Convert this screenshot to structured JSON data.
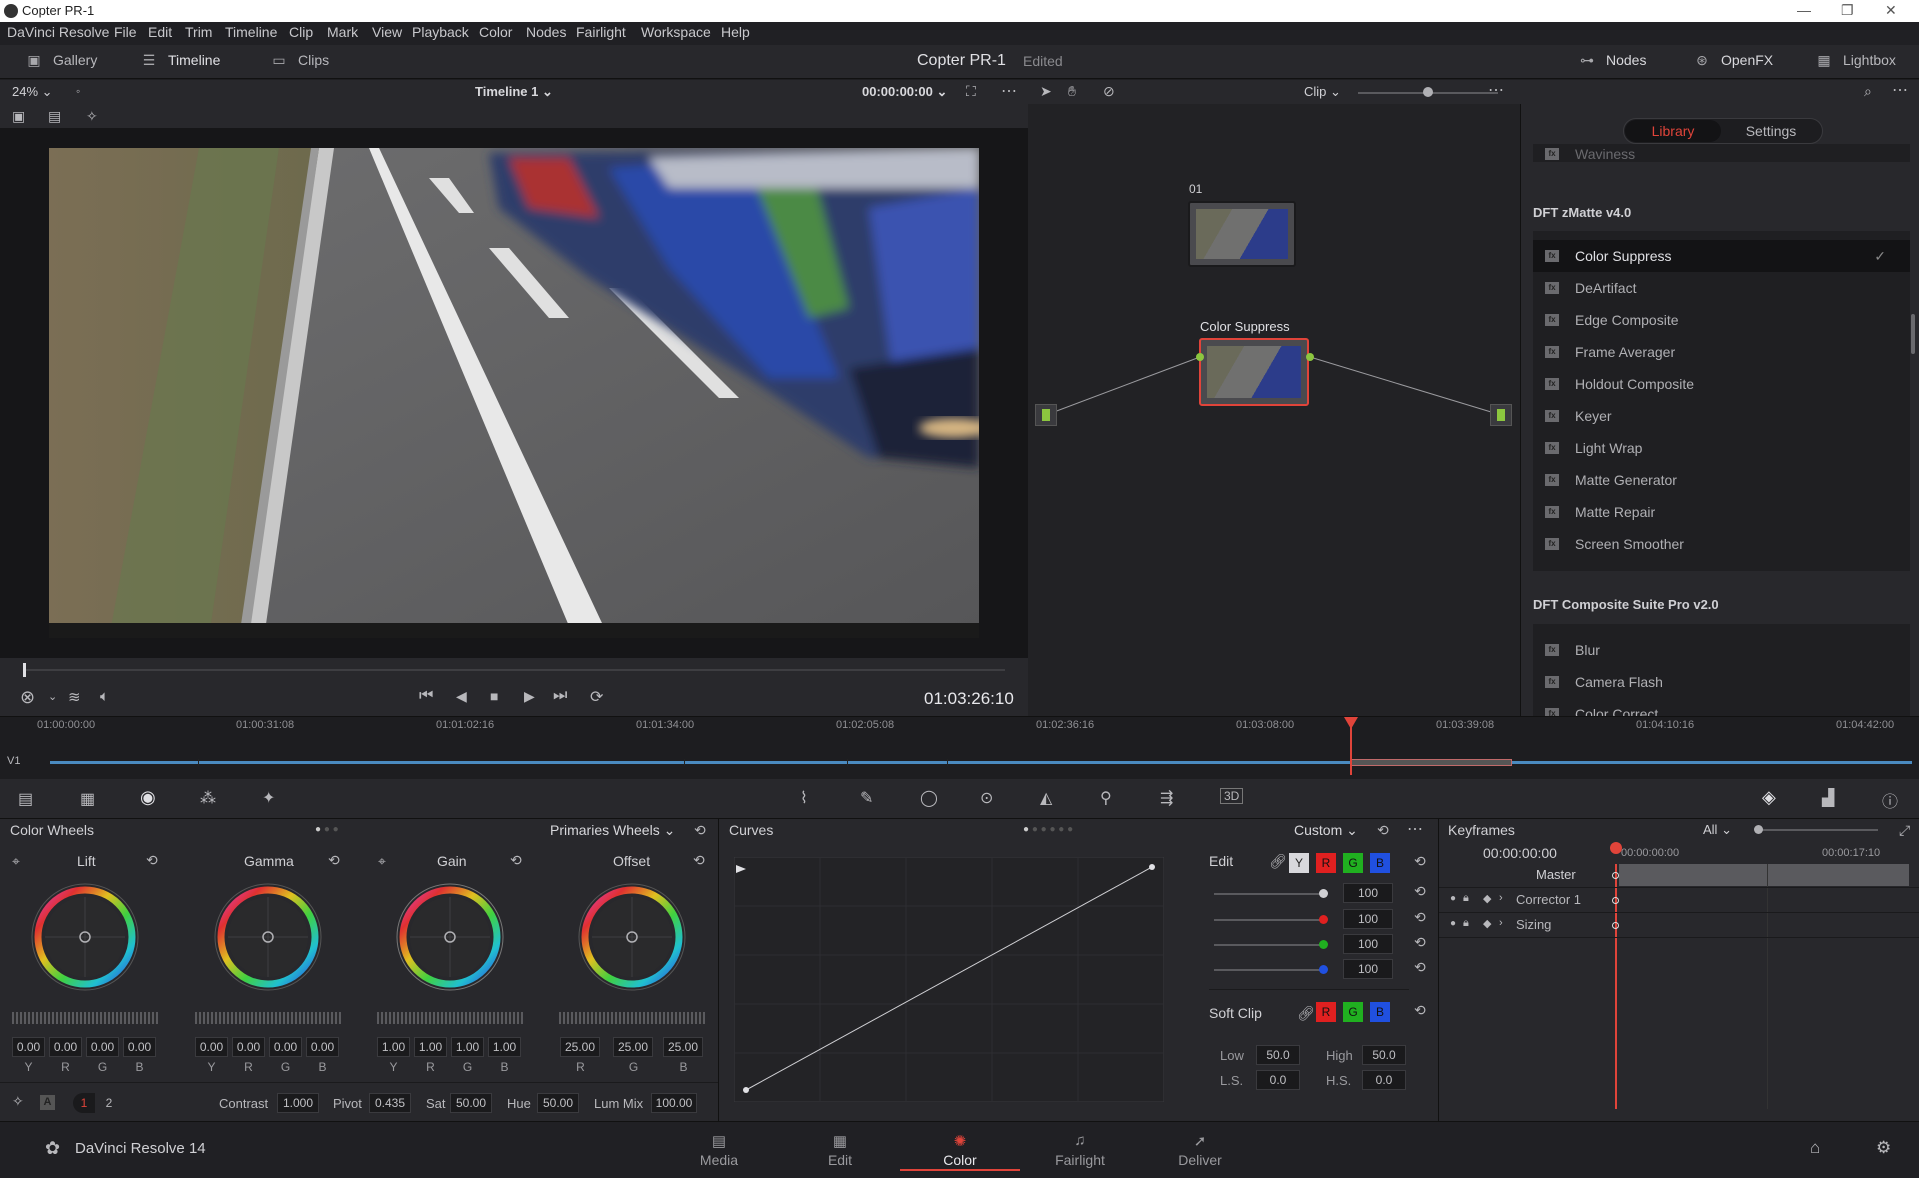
{
  "window": {
    "title": "Copter PR-1"
  },
  "menu": [
    "DaVinci Resolve",
    "File",
    "Edit",
    "Trim",
    "Timeline",
    "Clip",
    "Mark",
    "View",
    "Playback",
    "Color",
    "Nodes",
    "Fairlight",
    "Workspace",
    "Help"
  ],
  "toolbar": {
    "gallery": "Gallery",
    "timeline": "Timeline",
    "clips": "Clips",
    "project": "Copter PR-1",
    "status": "Edited",
    "nodes": "Nodes",
    "openfx": "OpenFX",
    "lightbox": "Lightbox"
  },
  "viewer": {
    "zoom": "24%",
    "timeline_name": "Timeline 1",
    "timecode": "00:00:00:00",
    "current_tc": "01:03:26:10"
  },
  "nodes_panel": {
    "mode": "Clip",
    "node1_label": "01",
    "node2_label": "Color Suppress",
    "zoom_level": 0.5
  },
  "library": {
    "tab_library": "Library",
    "tab_settings": "Settings",
    "partial_top": "Waviness",
    "group1": "DFT zMatte v4.0",
    "group1_items": [
      "Color Suppress",
      "DeArtifact",
      "Edge Composite",
      "Frame Averager",
      "Holdout Composite",
      "Keyer",
      "Light Wrap",
      "Matte Generator",
      "Matte Repair",
      "Screen Smoother"
    ],
    "group2": "DFT Composite Suite Pro v2.0",
    "group2_items": [
      "Blur",
      "Camera Flash",
      "Color Correct"
    ]
  },
  "timeline": {
    "track": "V1",
    "ruler": [
      "01:00:00:00",
      "01:00:31:08",
      "01:01:02:16",
      "01:01:34:00",
      "01:02:05:08",
      "01:02:36:16",
      "01:03:08:00",
      "01:03:39:08",
      "01:04:10:16",
      "01:04:42:00"
    ]
  },
  "color_wheels": {
    "title": "Color Wheels",
    "mode": "Primaries Wheels",
    "wheels": [
      {
        "name": "Lift",
        "values": [
          "0.00",
          "0.00",
          "0.00",
          "0.00"
        ],
        "labels": [
          "Y",
          "R",
          "G",
          "B"
        ]
      },
      {
        "name": "Gamma",
        "values": [
          "0.00",
          "0.00",
          "0.00",
          "0.00"
        ],
        "labels": [
          "Y",
          "R",
          "G",
          "B"
        ]
      },
      {
        "name": "Gain",
        "values": [
          "1.00",
          "1.00",
          "1.00",
          "1.00"
        ],
        "labels": [
          "Y",
          "R",
          "G",
          "B"
        ]
      },
      {
        "name": "Offset",
        "values": [
          "25.00",
          "25.00",
          "25.00"
        ],
        "labels": [
          "R",
          "G",
          "B"
        ]
      }
    ],
    "page1": "1",
    "page2": "2",
    "contrast_label": "Contrast",
    "contrast": "1.000",
    "pivot_label": "Pivot",
    "pivot": "0.435",
    "sat_label": "Sat",
    "sat": "50.00",
    "hue_label": "Hue",
    "hue": "50.00",
    "lummix_label": "Lum Mix",
    "lummix": "100.00"
  },
  "curves": {
    "title": "Curves",
    "mode": "Custom",
    "edit_label": "Edit",
    "channels": [
      "Y",
      "R",
      "G",
      "B"
    ],
    "edit_values": [
      "100",
      "100",
      "100",
      "100"
    ],
    "softclip_label": "Soft Clip",
    "low_label": "Low",
    "low": "50.0",
    "high_label": "High",
    "high": "50.0",
    "ls_label": "L.S.",
    "ls": "0.0",
    "hs_label": "H.S.",
    "hs": "0.0"
  },
  "keyframes": {
    "title": "Keyframes",
    "filter": "All",
    "tc": "00:00:00:00",
    "ruler": [
      "00:00:00:00",
      "00:00:17:10"
    ],
    "master": "Master",
    "rows": [
      "Corrector 1",
      "Sizing"
    ]
  },
  "pages": {
    "app": "DaVinci Resolve 14",
    "items": [
      "Media",
      "Edit",
      "Color",
      "Fairlight",
      "Deliver"
    ],
    "active": "Color"
  },
  "colors": {
    "accent": "#e0443a",
    "red": "#e02020",
    "green": "#20b020",
    "blue": "#2050e0",
    "node_green": "#8cc63f"
  }
}
